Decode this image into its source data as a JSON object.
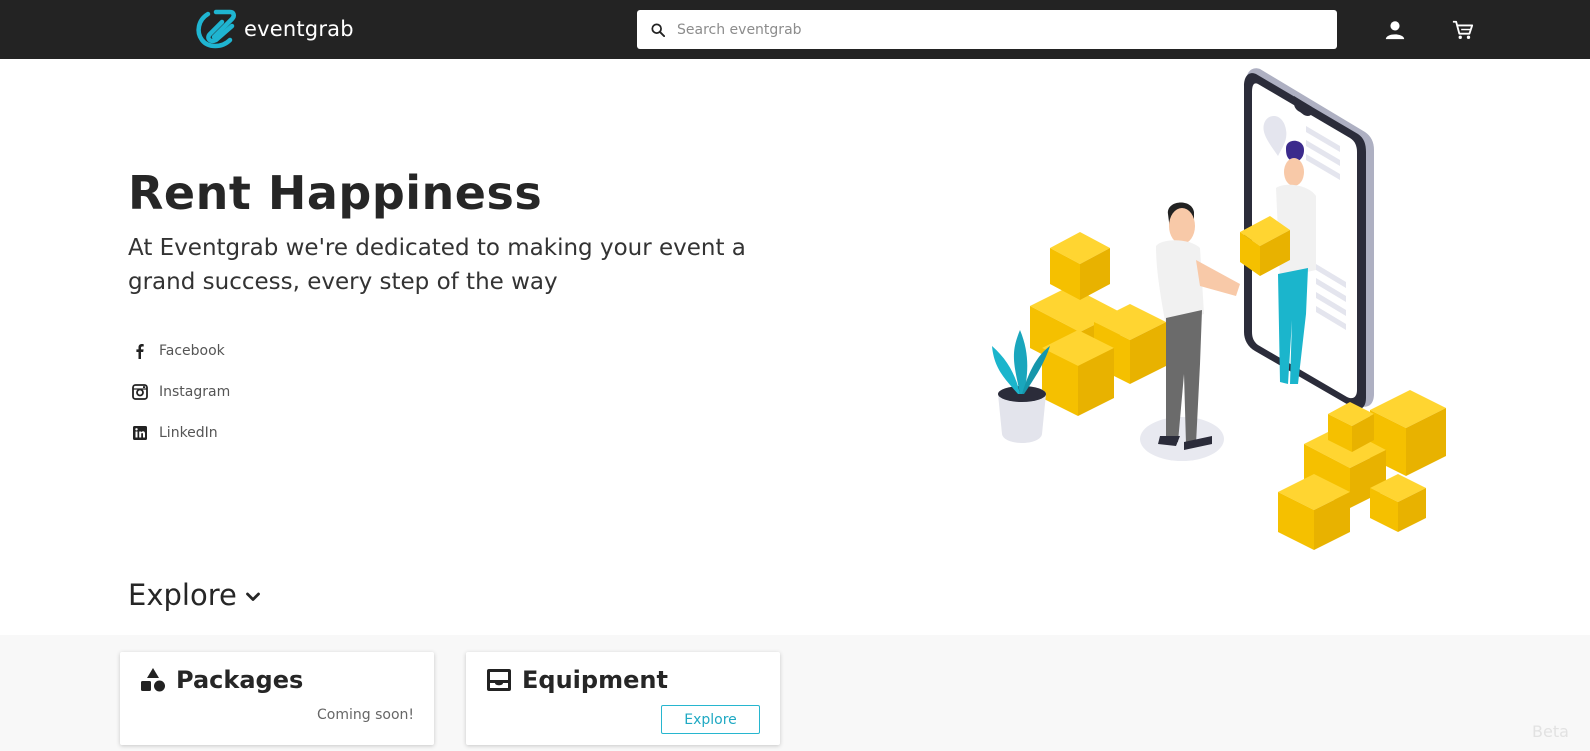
{
  "header": {
    "brand": "eventgrab",
    "search_placeholder": "Search eventgrab",
    "icons": [
      "logo-icon",
      "search-icon",
      "account-icon",
      "cart-icon"
    ],
    "accent": "#1fb5d1",
    "background": "#232323"
  },
  "hero": {
    "title": "Rent Happiness",
    "subtitle": "At Eventgrab we're dedicated to making your event a grand success, every step of the way",
    "socials": [
      {
        "label": "Facebook",
        "icon": "facebook-icon"
      },
      {
        "label": "Instagram",
        "icon": "instagram-icon"
      },
      {
        "label": "LinkedIn",
        "icon": "linkedin-icon"
      }
    ]
  },
  "explore": {
    "label": "Explore",
    "icon": "chevron-down-icon"
  },
  "cards": {
    "packages": {
      "title": "Packages",
      "status": "Coming soon!",
      "icon": "shapes-icon"
    },
    "equipment": {
      "title": "Equipment",
      "button": "Explore",
      "icon": "inbox-icon"
    }
  },
  "badge": {
    "label": "Beta"
  }
}
